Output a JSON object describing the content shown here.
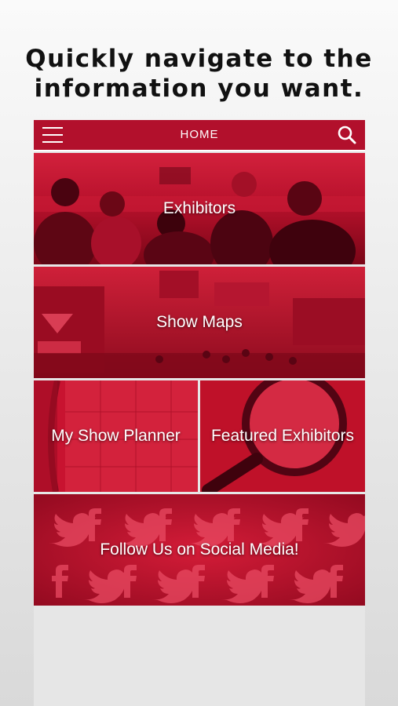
{
  "headline": {
    "line1": "Quickly navigate to the",
    "line2": "information you want."
  },
  "navbar": {
    "title": "HOME",
    "menu_icon": "hamburger-menu-icon",
    "search_icon": "search-icon"
  },
  "tiles": [
    {
      "label": "Exhibitors"
    },
    {
      "label": "Show Maps"
    },
    {
      "label": "My Show Planner"
    },
    {
      "label": "Featured Exhibitors"
    },
    {
      "label": "Follow Us on Social Media!"
    }
  ],
  "colors": {
    "brand_red": "#b2102c",
    "tile_red": "#c4112e",
    "background": "#e6e6e6"
  }
}
